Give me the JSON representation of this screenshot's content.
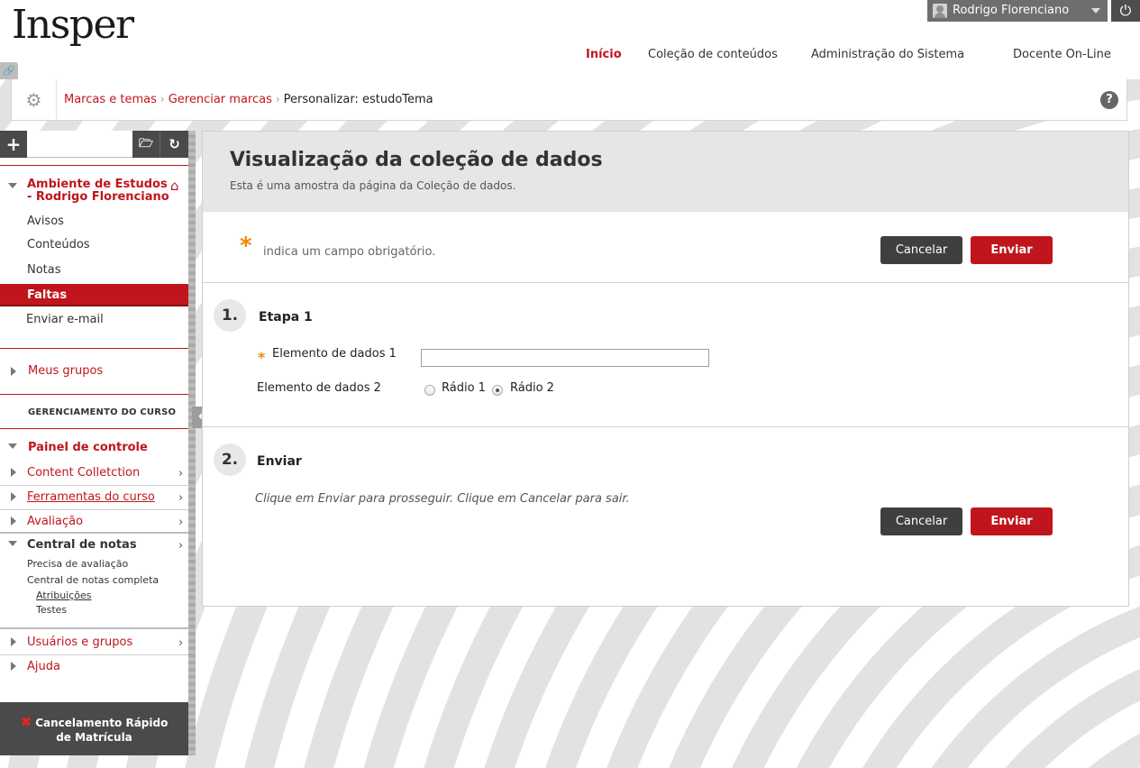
{
  "header": {
    "logo": "Insper",
    "user_name": "Rodrigo Florenciano",
    "nav": {
      "inicio": "Início",
      "colecao": "Coleção de conteúdos",
      "admin": "Administração do Sistema",
      "docente": "Docente On-Line"
    }
  },
  "breadcrumb": {
    "item1": "Marcas e temas",
    "item2": "Gerenciar marcas",
    "current": "Personalizar: estudoTema",
    "separator": "›",
    "help": "?"
  },
  "sidebar": {
    "course_title": "Ambiente de Estudos - Rodrigo Florenciano",
    "items": {
      "avisos": "Avisos",
      "conteudos": "Conteúdos",
      "notas": "Notas",
      "faltas": "Faltas",
      "email": "Enviar e-mail"
    },
    "meus_grupos": "Meus grupos",
    "section_management": "GERENCIAMENTO DO CURSO",
    "control_panel": {
      "title": "Painel de controle",
      "content_collection": "Content Colletction",
      "ferramentas": "Ferramentas do curso",
      "avaliacao": "Avaliação",
      "central_notas": "Central de notas",
      "precisa_avaliacao": "Precisa de avaliação",
      "central_completa": "Central de notas completa",
      "atribuicoes": "Atribuições",
      "testes": "Testes",
      "usuarios_grupos": "Usuários e grupos",
      "ajuda": "Ajuda"
    },
    "quick_unenroll": {
      "line1": "Cancelamento Rápido",
      "line2": "de Matrícula"
    }
  },
  "main": {
    "title": "Visualização da coleção de dados",
    "subtitle": "Esta é uma amostra da página da Coleção de dados.",
    "required_star": "*",
    "required_note": "indica um campo obrigatório.",
    "cancel_label": "Cancelar",
    "submit_label": "Enviar",
    "step1": {
      "number": "1.",
      "title": "Etapa 1",
      "field1_label": "Elemento de dados 1",
      "field1_value": "",
      "field2_label": "Elemento de dados 2",
      "radio1": "Rádio 1",
      "radio2": "Rádio 2",
      "selected_radio": "Rádio 2"
    },
    "step2": {
      "number": "2.",
      "title": "Enviar",
      "instructions": "Clique em Enviar para prosseguir. Clique em Cancelar para sair."
    }
  }
}
